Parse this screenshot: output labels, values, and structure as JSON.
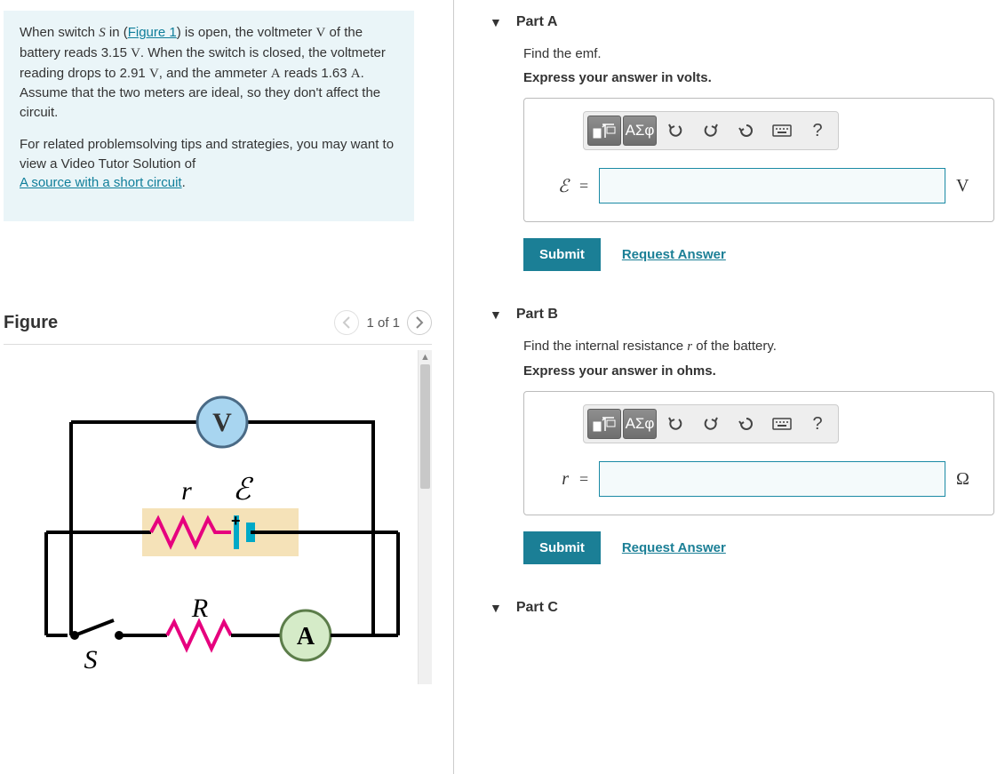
{
  "problem": {
    "p1_prefix": "When switch ",
    "p1_switch": "S",
    "p1_in": " in (",
    "figure_link": "Figure 1",
    "p1_after": ") is open, the voltmeter ",
    "v": "V",
    "p1_of": " of the battery reads 3.15 ",
    "p1_dot1": ". When the switch is closed, the voltmeter reading drops to 2.91 ",
    "p1_and": ", and the ammeter ",
    "a": "A",
    "p1_reads": " reads 1.63 ",
    "p1_assume": ". Assume that the two meters are ideal, so they don't affect the circuit.",
    "p2_prefix": "For related problemsolving tips and strategies, you may want to view a Video Tutor Solution of ",
    "video_link": "A source with a short circuit",
    "p2_suffix": "."
  },
  "figure": {
    "title": "Figure",
    "counter": "1 of 1",
    "labels": {
      "V": "V",
      "r": "r",
      "E": "ℰ",
      "R": "R",
      "A": "A",
      "S": "S"
    }
  },
  "partA": {
    "title": "Part A",
    "prompt": "Find the emf.",
    "express": "Express your answer in volts.",
    "var": "ℰ",
    "eq": "=",
    "unit": "V",
    "submit": "Submit",
    "request": "Request Answer"
  },
  "partB": {
    "title": "Part B",
    "prompt_prefix": "Find the internal resistance ",
    "prompt_var": "r",
    "prompt_suffix": " of the battery.",
    "express": "Express your answer in ohms.",
    "var": "r",
    "eq": "=",
    "unit": "Ω",
    "submit": "Submit",
    "request": "Request Answer"
  },
  "partC": {
    "title": "Part C"
  },
  "toolbar": {
    "greek": "ΑΣφ",
    "help": "?"
  }
}
